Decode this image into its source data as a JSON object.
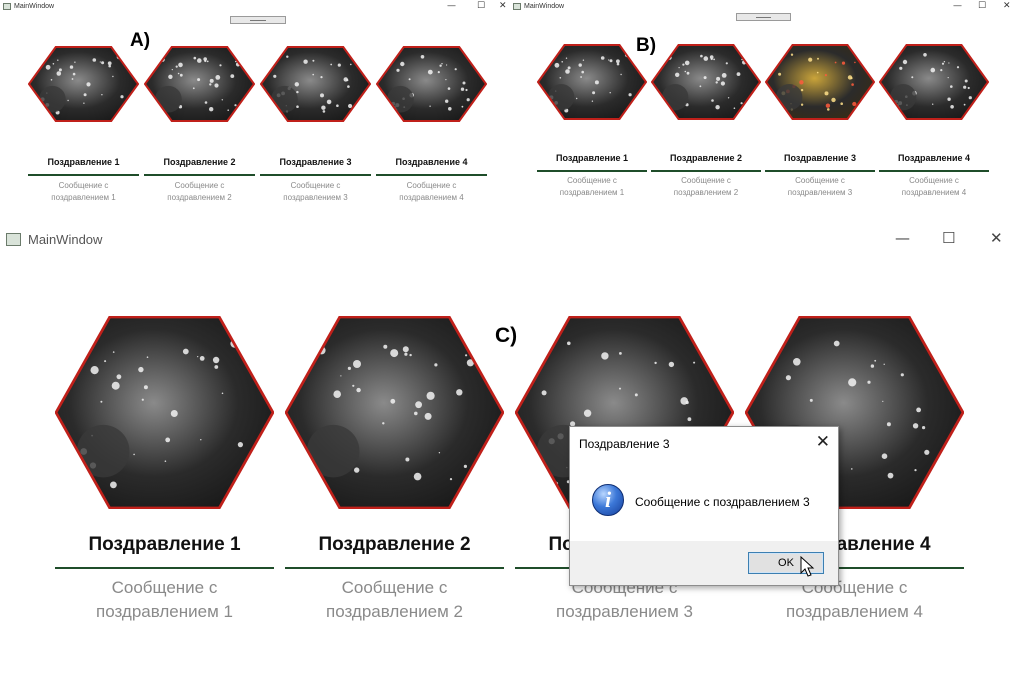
{
  "panelA": {
    "label": "A)",
    "window_title": "MainWindow",
    "cards": [
      {
        "title": "Поздравление 1",
        "message_line1": "Сообщение с",
        "message_line2": "поздравлением 1"
      },
      {
        "title": "Поздравление 2",
        "message_line1": "Сообщение с",
        "message_line2": "поздравлением 2"
      },
      {
        "title": "Поздравление 3",
        "message_line1": "Сообщение с",
        "message_line2": "поздравлением 3"
      },
      {
        "title": "Поздравление 4",
        "message_line1": "Сообщение с",
        "message_line2": "поздравлением 4"
      }
    ]
  },
  "panelB": {
    "label": "B)",
    "window_title": "MainWindow",
    "cards": [
      {
        "title": "Поздравление 1",
        "message_line1": "Сообщение с",
        "message_line2": "поздравлением 1"
      },
      {
        "title": "Поздравление 2",
        "message_line1": "Сообщение с",
        "message_line2": "поздравлением 2"
      },
      {
        "title": "Поздравление 3",
        "message_line1": "Сообщение с",
        "message_line2": "поздравлением 3"
      },
      {
        "title": "Поздравление 4",
        "message_line1": "Сообщение с",
        "message_line2": "поздравлением 4"
      }
    ],
    "highlighted_card": 3
  },
  "panelC": {
    "label": "C)",
    "window_title": "MainWindow",
    "cards": [
      {
        "title": "Поздравление 1",
        "message_line1": "Сообщение с",
        "message_line2": "поздравлением 1"
      },
      {
        "title": "Поздравление 2",
        "message_line1": "Сообщение с",
        "message_line2": "поздравлением 2"
      },
      {
        "title": "Поздравление 3",
        "message_line1": "Сообщение с",
        "message_line2": "поздравлением 3"
      },
      {
        "title": "Поздравление 4",
        "message_line1": "Сообщение с",
        "message_line2": "поздравлением 4"
      }
    ],
    "dialog": {
      "title": "Поздравление 3",
      "message": "Сообщение с поздравлением 3",
      "ok_label": "OK",
      "close_glyph": "✕",
      "icon": "info-icon"
    }
  },
  "window_controls": {
    "minimize": "—",
    "maximize": "☐",
    "close": "✕"
  },
  "colors": {
    "hex_border": "#c0201a",
    "divider": "#1f4d2a",
    "message_text": "#8a8a8a",
    "highlight_photo": "#caa43a"
  }
}
